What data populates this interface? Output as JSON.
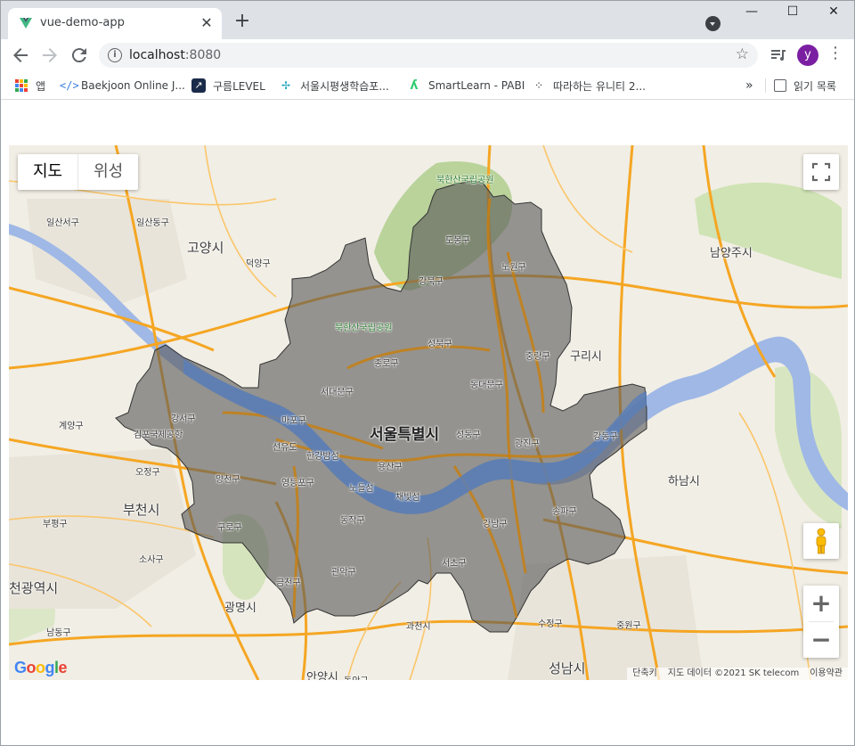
{
  "browser": {
    "tab_title": "vue-demo-app",
    "tab_close": "✕",
    "new_tab": "+",
    "window_minimize": "—",
    "window_maximize": "☐",
    "window_close": "✕",
    "url_host": "localhost",
    "url_port": ":8080",
    "profile_initial": "y",
    "accent_color": "#7b1fa2"
  },
  "bookmarks": {
    "apps": "앱",
    "items": [
      {
        "label": "Baekjoon Online J...",
        "icon": "code-icon"
      },
      {
        "label": "구름LEVEL",
        "icon": "goorm-icon"
      },
      {
        "label": "서울시평생학습포...",
        "icon": "seoul-icon"
      },
      {
        "label": "SmartLearn - PABI",
        "icon": "smartlearn-icon"
      },
      {
        "label": "따라하는 유니티 2...",
        "icon": "dots-icon"
      }
    ],
    "overflow": "»",
    "reading_list": "읽기 목록"
  },
  "map": {
    "map_type_map": "지도",
    "map_type_satellite": "위성",
    "zoom_in": "+",
    "zoom_out": "−",
    "attribution": {
      "shortcuts": "단축키",
      "data": "지도 데이터 ©2021 SK telecom",
      "terms": "이용약관"
    },
    "google": "Google",
    "labels": {
      "seoul": "서울특별시",
      "goyang": "고양시",
      "namyangju": "남양주시",
      "guri": "구리시",
      "hanam": "하남시",
      "bucheon": "부천시",
      "incheon": "천광역시",
      "gwangmyeong": "광명시",
      "seongnam": "성남시",
      "anyang": "안양시",
      "gwacheon": "과천시",
      "ilsanseo": "일산서구",
      "ilsandong": "일산동구",
      "deogyang": "덕양구",
      "gyeyang": "계양구",
      "bupyeong": "부평구",
      "namdong": "남동구",
      "sosa": "소사구",
      "ojeong": "오정구",
      "sujeong": "수정구",
      "jungwon": "중원구",
      "dobong": "도봉구",
      "nowon": "노원구",
      "gangbuk": "강북구",
      "seongbuk": "성북구",
      "jungnang": "중랑구",
      "jongno": "종로구",
      "dongdaemun": "동대문구",
      "seodaemun": "서대문구",
      "mapo": "마포구",
      "gangseo": "강서구",
      "yongsan": "용산구",
      "seongdong": "성동구",
      "gwangjin": "광진구",
      "gangdong": "강동구",
      "yangcheon": "양천구",
      "yeongdeungpo": "영등포구",
      "guro": "구로구",
      "dongjak": "동작구",
      "gwanak": "관악구",
      "geumcheon": "금천구",
      "seocho": "서초구",
      "gangnam": "강남구",
      "songpa": "송파구",
      "gimpo_airport": "김포국제공항",
      "bukhansan": "북한산국립공원",
      "bukhansan2": "북한산국립공원",
      "seonyudo": "선유도",
      "hangang_park": "한강밤섬",
      "nodeulseom": "노들섬",
      "chaebitseom": "채빛섬",
      "dongan": "동안구"
    }
  }
}
